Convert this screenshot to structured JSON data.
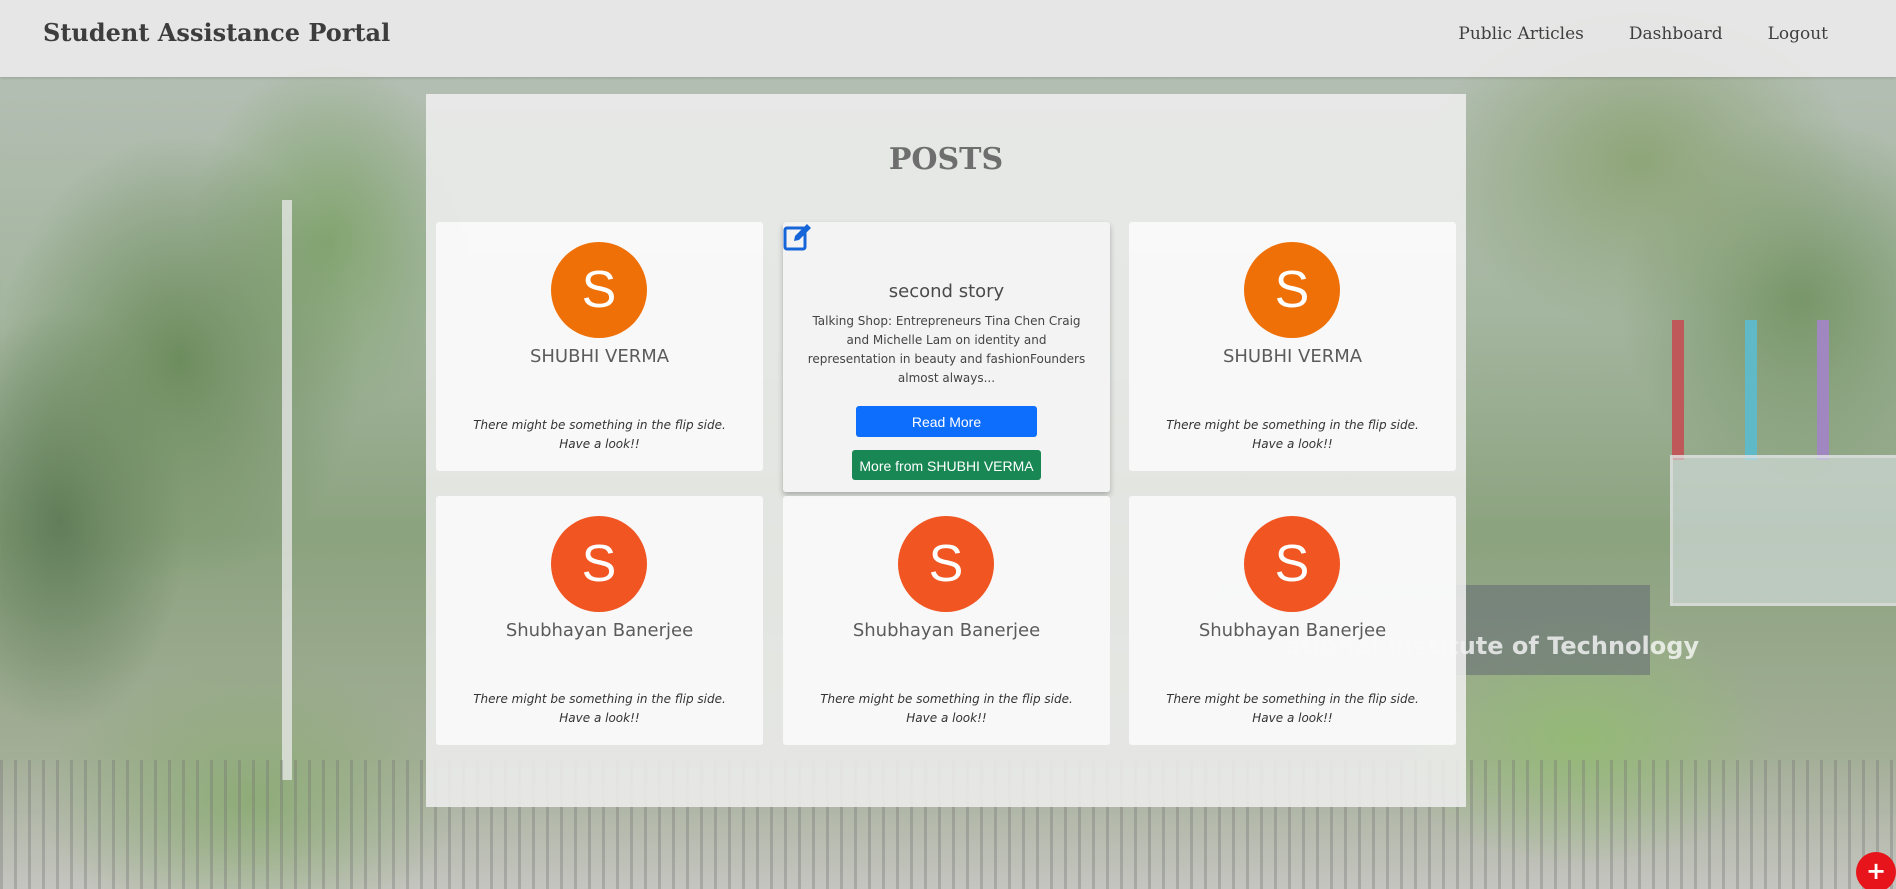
{
  "navbar": {
    "brand": "Student Assistance Portal",
    "links": [
      "Public Articles",
      "Dashboard",
      "Logout"
    ]
  },
  "main": {
    "title": "POSTS",
    "cards": [
      {
        "avatar_letter": "S",
        "avatar_color": "#ef7007",
        "name": "SHUBHI VERMA",
        "description": "There might be something in the flip side. Have a look!!"
      },
      {
        "story_title": "second story",
        "story_excerpt": "Talking Shop: Entrepreneurs Tina Chen Craig and Michelle Lam on identity and representation in beauty and fashionFounders almost always...",
        "read_more_label": "Read More",
        "more_from_label": "More from SHUBHI VERMA",
        "icon": "edit-icon"
      },
      {
        "avatar_letter": "S",
        "avatar_color": "#ef7007",
        "name": "SHUBHI VERMA",
        "description": "There might be something in the flip side. Have a look!!"
      },
      {
        "avatar_letter": "S",
        "avatar_color": "#f05522",
        "name": "Shubhayan Banerjee",
        "description": "There might be something in the flip side. Have a look!!"
      },
      {
        "avatar_letter": "S",
        "avatar_color": "#f05522",
        "name": "Shubhayan Banerjee",
        "description": "There might be something in the flip side. Have a look!!"
      },
      {
        "avatar_letter": "S",
        "avatar_color": "#f05522",
        "name": "Shubhayan Banerjee",
        "description": "There might be something in the flip side. Have a look!!"
      }
    ]
  },
  "fab": {
    "label": "+",
    "color": "#e8141c"
  },
  "background": {
    "sign_text": "ational Institute of Technology"
  },
  "colors": {
    "primary_button": "#0d6efd",
    "success_button": "#198754"
  }
}
